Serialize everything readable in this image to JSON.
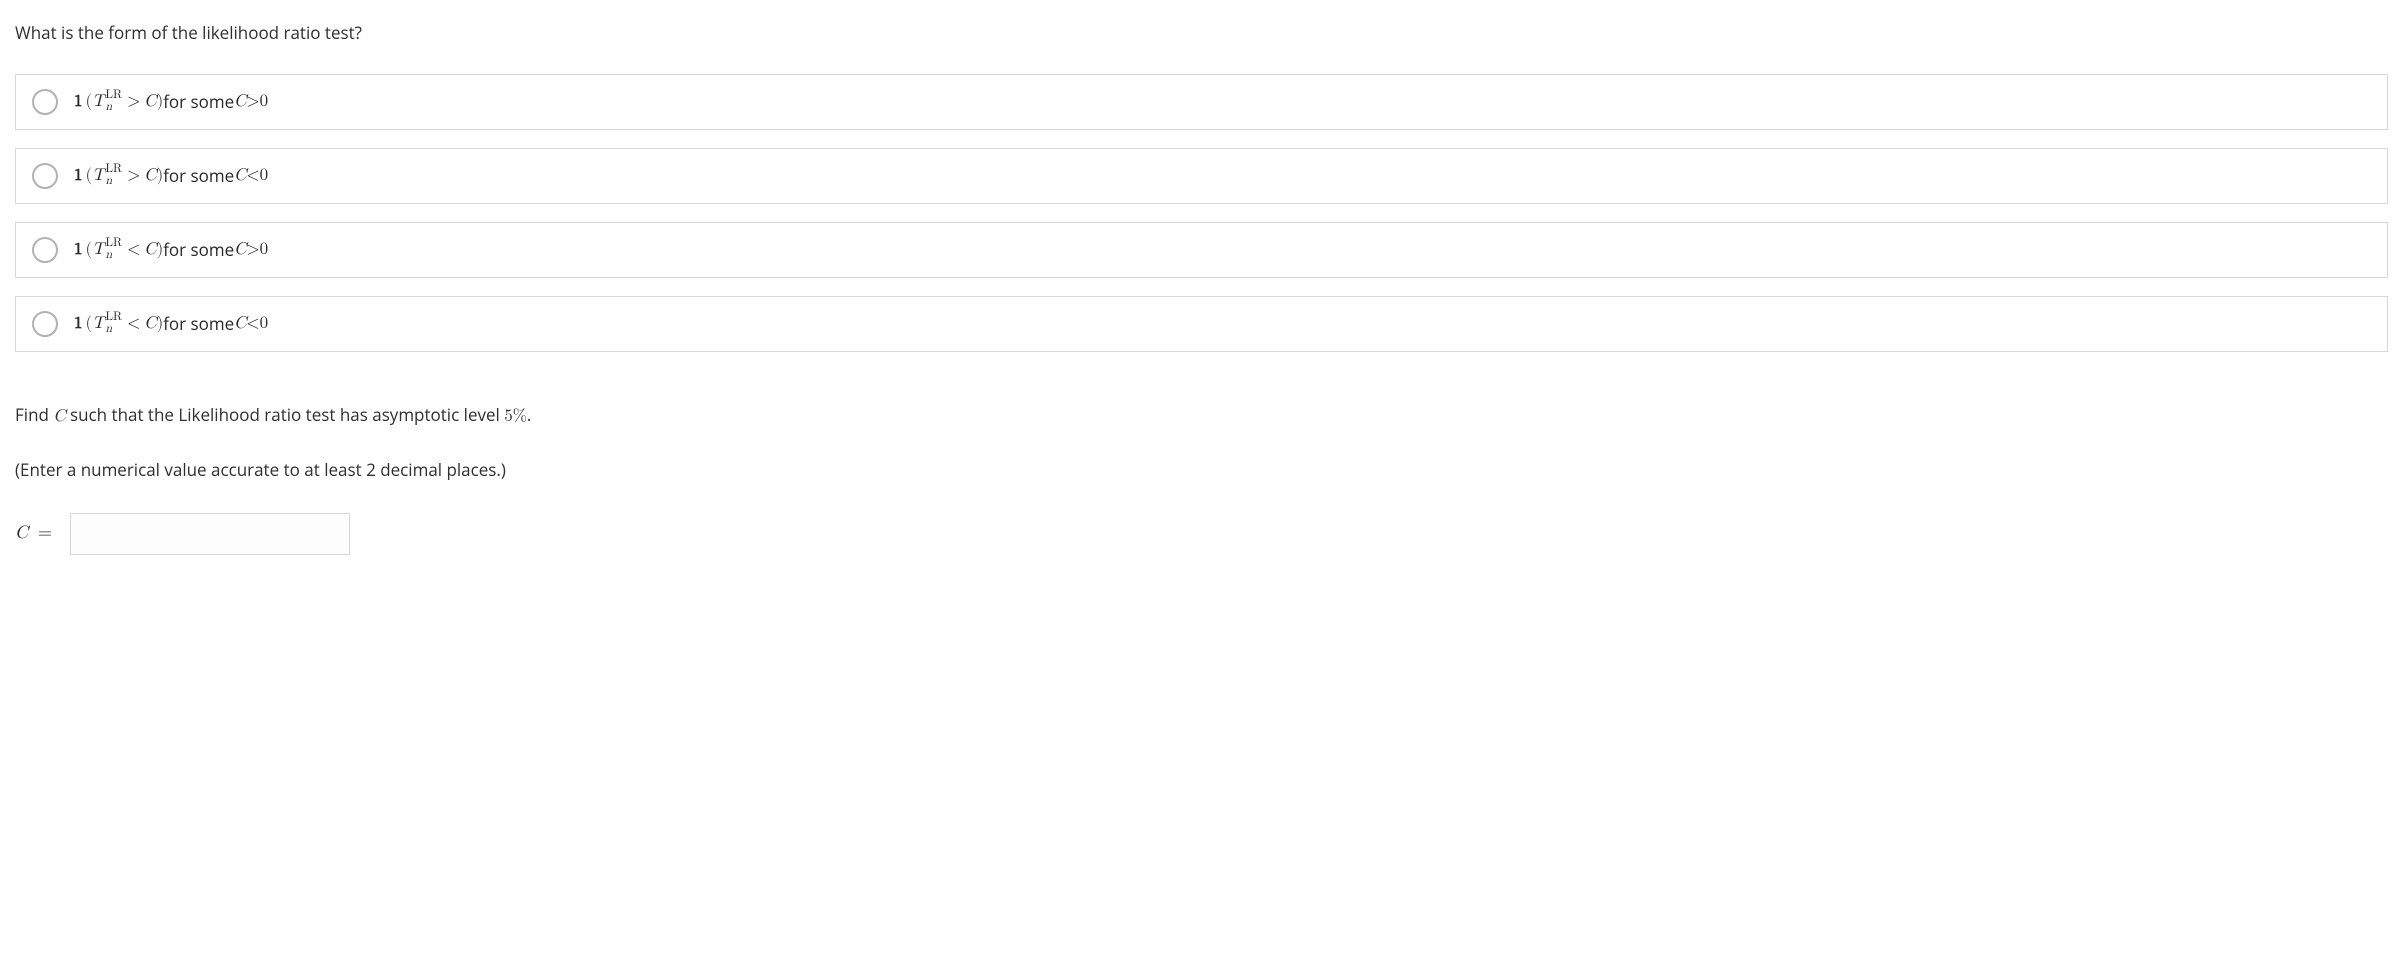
{
  "question1": {
    "text": "What is the form of the likelihood ratio test?"
  },
  "options": [
    {
      "indicator_prefix": "1",
      "paren_open": "(",
      "T": "T",
      "sup": "LR",
      "sub": "n",
      "rel": ">",
      "C1": "C",
      "paren_close": ")",
      "mid": " for some ",
      "C2": "C",
      "cond": ">0"
    },
    {
      "indicator_prefix": "1",
      "paren_open": "(",
      "T": "T",
      "sup": "LR",
      "sub": "n",
      "rel": ">",
      "C1": "C",
      "paren_close": ")",
      "mid": " for some ",
      "C2": "C",
      "cond": "<0"
    },
    {
      "indicator_prefix": "1",
      "paren_open": "(",
      "T": "T",
      "sup": "LR",
      "sub": "n",
      "rel": "<",
      "C1": "C",
      "paren_close": ")",
      "mid": " for some ",
      "C2": "C",
      "cond": ">0"
    },
    {
      "indicator_prefix": "1",
      "paren_open": "(",
      "T": "T",
      "sup": "LR",
      "sub": "n",
      "rel": "<",
      "C1": "C",
      "paren_close": ")",
      "mid": " for some ",
      "C2": "C",
      "cond": "<0"
    }
  ],
  "question2": {
    "prefix": "Find ",
    "C_var": "C",
    "mid1": " such that the Likelihood ratio test has asymptotic level ",
    "five": "5%",
    "period": "."
  },
  "hint": {
    "text": "(Enter a numerical value accurate to at least 2 decimal places.)"
  },
  "answer": {
    "label": "C",
    "equals": "=",
    "value": ""
  }
}
